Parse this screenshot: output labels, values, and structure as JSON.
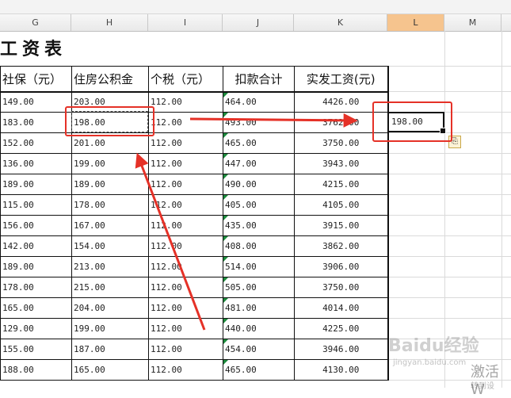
{
  "columns": [
    "G",
    "H",
    "I",
    "J",
    "K",
    "L",
    "M"
  ],
  "selected_column": "L",
  "sheet_title": "工资表",
  "headers": [
    "社保（元）",
    "住房公积金",
    "个税（元）",
    "扣款合计",
    "实发工资(元)"
  ],
  "rows": [
    [
      "149.00",
      "203.00",
      "112.00",
      "464.00",
      "4426.00"
    ],
    [
      "183.00",
      "198.00",
      "112.00",
      "493.00",
      "3762.00"
    ],
    [
      "152.00",
      "201.00",
      "112.00",
      "465.00",
      "3750.00"
    ],
    [
      "136.00",
      "199.00",
      "112.00",
      "447.00",
      "3943.00"
    ],
    [
      "189.00",
      "189.00",
      "112.00",
      "490.00",
      "4215.00"
    ],
    [
      "115.00",
      "178.00",
      "112.00",
      "405.00",
      "4105.00"
    ],
    [
      "156.00",
      "167.00",
      "112.00",
      "435.00",
      "3915.00"
    ],
    [
      "142.00",
      "154.00",
      "112.00",
      "408.00",
      "3862.00"
    ],
    [
      "189.00",
      "213.00",
      "112.00",
      "514.00",
      "3906.00"
    ],
    [
      "178.00",
      "215.00",
      "112.00",
      "505.00",
      "3750.00"
    ],
    [
      "165.00",
      "204.00",
      "112.00",
      "481.00",
      "4014.00"
    ],
    [
      "129.00",
      "199.00",
      "112.00",
      "440.00",
      "4225.00"
    ],
    [
      "155.00",
      "187.00",
      "112.00",
      "454.00",
      "3946.00"
    ],
    [
      "188.00",
      "165.00",
      "112.00",
      "465.00",
      "4130.00"
    ]
  ],
  "pasted_cell": {
    "column": "L",
    "value": "198.00"
  },
  "paste_options_icon": "clipboard-icon",
  "watermark": {
    "brand": "Baidu经验",
    "url": "jingyan.baidu.com"
  },
  "activate_notice": {
    "line1": "激活 W",
    "line2": "转到设"
  },
  "accent_colors": {
    "annotation_red": "#e53127",
    "selected_header": "#f6c48e",
    "error_flag": "#1c8a3c"
  }
}
